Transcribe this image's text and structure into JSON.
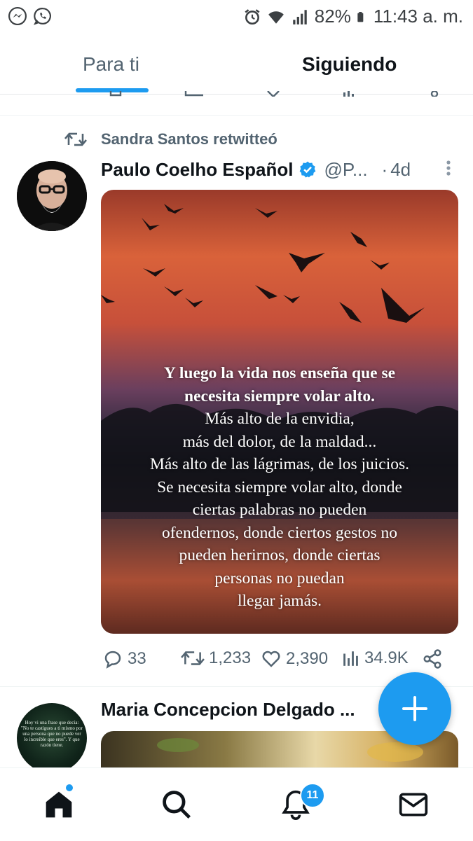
{
  "status_bar": {
    "left_icons": [
      "messenger-icon",
      "whatsapp-icon"
    ],
    "right_icons": [
      "alarm-icon",
      "wifi-icon",
      "signal-icon",
      "battery-icon"
    ],
    "battery": "82%",
    "time": "11:43 a. m."
  },
  "tabs": {
    "for_you": "Para ti",
    "following": "Siguiendo",
    "active": "for_you"
  },
  "tweet": {
    "retweeted_by": "Sandra Santos retwitteó",
    "author_name": "Paulo Coelho Español",
    "verified": true,
    "handle": "@P...",
    "separator": "·",
    "time": "4d",
    "image_text": [
      "Y luego la vida nos enseña que se",
      "necesita siempre volar alto.",
      "Más alto de la envidia,",
      "más del dolor, de la maldad...",
      "Más alto de las lágrimas, de los juicios.",
      "Se necesita siempre volar alto, donde",
      "ciertas palabras no pueden",
      "ofendernos, donde ciertos gestos no",
      "pueden herirnos, donde ciertas",
      "personas no puedan",
      "llegar jamás."
    ],
    "replies": "33",
    "retweets": "1,233",
    "likes": "2,390",
    "views": "34.9K"
  },
  "next_tweet": {
    "author_name": "Maria Concepcion Delgado ...",
    "avatar_text": "Hoy vi una frase que decía: \"No te castigues a ti mismo por una persona que no puede ver lo increíble que eres\". Y que razón tiene."
  },
  "bottom_nav": {
    "items": [
      "home-icon",
      "search-icon",
      "bell-icon",
      "mail-icon"
    ],
    "notifications_badge": "11"
  },
  "colors": {
    "accent": "#1d9bf0",
    "text_primary": "#0f1419",
    "text_secondary": "#536471"
  }
}
